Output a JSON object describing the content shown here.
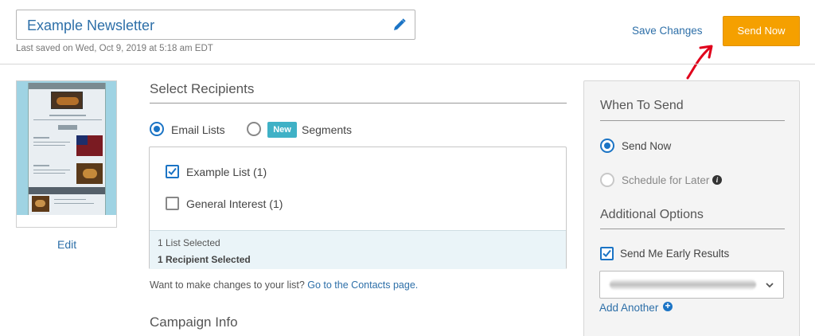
{
  "header": {
    "campaign_name": "Example Newsletter",
    "last_saved": "Last saved on Wed, Oct 9, 2019 at 5:18 am EDT",
    "save_changes": "Save Changes",
    "send_now": "Send Now"
  },
  "thumbnail": {
    "edit_label": "Edit"
  },
  "recipients": {
    "title": "Select Recipients",
    "option_email_lists": "Email Lists",
    "option_segments": "Segments",
    "new_badge": "New",
    "lists": [
      {
        "label": "Example List (1)",
        "checked": true
      },
      {
        "label": "General Interest (1)",
        "checked": false
      }
    ],
    "lists_selected": "1 List Selected",
    "recipients_selected": "1 Recipient Selected",
    "changes_prompt": "Want to make changes to your list?",
    "contacts_link": "Go to the Contacts page."
  },
  "campaign_info": {
    "title": "Campaign Info"
  },
  "when_to_send": {
    "title": "When To Send",
    "send_now": "Send Now",
    "schedule_later": "Schedule for Later",
    "additional_title": "Additional Options",
    "early_results": "Send Me Early Results",
    "add_another": "Add Another"
  },
  "colors": {
    "accent": "#1b74c5",
    "link": "#2d6fa8",
    "send_button": "#f5a000",
    "new_badge": "#3fb1c6",
    "annotation_arrow": "#e0001b"
  }
}
